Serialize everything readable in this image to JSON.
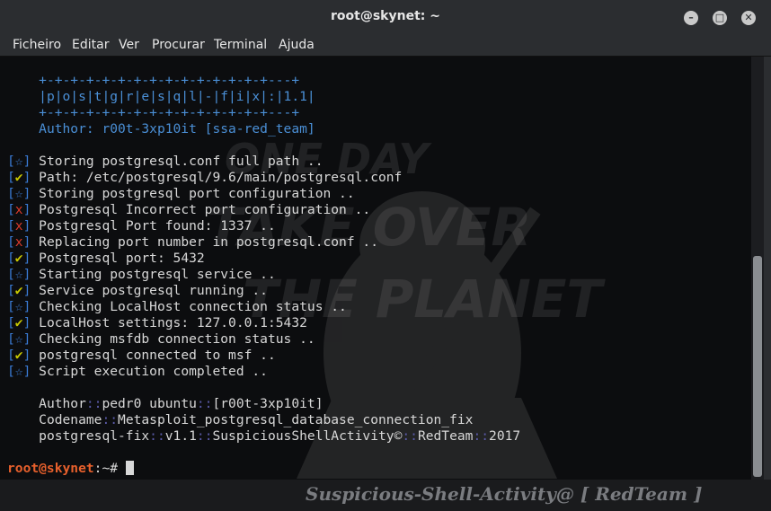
{
  "window": {
    "title": "root@skynet: ~"
  },
  "menu": [
    "Ficheiro",
    "Editar",
    "Ver",
    "Procurar",
    "Terminal",
    "Ajuda"
  ],
  "banner": {
    "border": "+-+-+-+-+-+-+-+-+-+-+-+-+-+-+---+",
    "name": "|p|o|s|t|g|r|e|s|q|l|-|f|i|x|:|1.1|",
    "author": "Author: r00t-3xp10it [ssa-red_team]"
  },
  "log": [
    {
      "tag": "☆",
      "kind": "star",
      "text": "Storing postgresql.conf full path .."
    },
    {
      "tag": "✔",
      "kind": "check",
      "text": "Path: /etc/postgresql/9.6/main/postgresql.conf"
    },
    {
      "tag": "☆",
      "kind": "star",
      "text": "Storing postgresql port configuration .."
    },
    {
      "tag": "x",
      "kind": "x",
      "text": "Postgresql Incorrect port configuration .."
    },
    {
      "tag": "x",
      "kind": "x",
      "text": "Postgresql Port found: 1337 .."
    },
    {
      "tag": "x",
      "kind": "x",
      "text": "Replacing port number in postgresql.conf .."
    },
    {
      "tag": "✔",
      "kind": "check",
      "text": "Postgresql port: 5432"
    },
    {
      "tag": "☆",
      "kind": "star",
      "text": "Starting postgresql service .."
    },
    {
      "tag": "✔",
      "kind": "check",
      "text": "Service postgresql running .."
    },
    {
      "tag": "☆",
      "kind": "star",
      "text": "Checking LocalHost connection status .."
    },
    {
      "tag": "✔",
      "kind": "check",
      "text": "LocalHost settings: 127.0.0.1:5432"
    },
    {
      "tag": "☆",
      "kind": "star",
      "text": "Checking msfdb connection status .."
    },
    {
      "tag": "✔",
      "kind": "check",
      "text": "postgresql connected to msf .."
    },
    {
      "tag": "☆",
      "kind": "star",
      "text": "Script execution completed .."
    }
  ],
  "credits": {
    "author_label": "Author",
    "author_sep": "::",
    "author_name": "pedr0 ubuntu",
    "author_sep2": "::",
    "author_team": "[r00t-3xp10it]",
    "codename_label": "Codename",
    "codename_sep": "::",
    "codename_value": "Metasploit_postgresql_database_connection_fix",
    "fix_name": "postgresql-fix",
    "fix_sep1": "::",
    "fix_version": "v1.1",
    "fix_sep2": "::",
    "fix_source": "SuspiciousShellActivity©",
    "fix_sep3": "::",
    "fix_team": "RedTeam",
    "fix_sep4": "::",
    "fix_year": "2017"
  },
  "prompt": {
    "user_host": "root@skynet",
    "path": ":~# "
  },
  "wallpaper_text": [
    "ONE DAY",
    "TAKE OVER",
    "THE PLANET"
  ],
  "footer": "Suspicious-Shell-Activity@ [ RedTeam ]",
  "colors": {
    "titlebar": "#2b2d30",
    "terminal_bg": "#0c0d0f",
    "banner": "#4a8fd6",
    "prompt": "#e8602c",
    "check": "#c8c800",
    "x": "#d83a2a",
    "star": "#3a7bd5"
  }
}
